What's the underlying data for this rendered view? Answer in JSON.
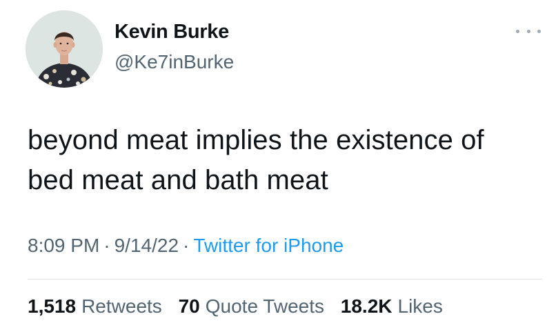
{
  "author": {
    "name": "Kevin Burke",
    "handle": "@Ke7inBurke",
    "avatar": "profile-photo"
  },
  "tweet": {
    "lines": [
      "beyond meat implies the existence of",
      "bed meat and bath meat"
    ]
  },
  "meta": {
    "time": "8:09 PM",
    "separator": "·",
    "date": "9/14/22",
    "source": "Twitter for iPhone"
  },
  "stats": {
    "retweets": {
      "count": "1,518",
      "label": "Retweets"
    },
    "quotes": {
      "count": "70",
      "label": "Quote Tweets"
    },
    "likes": {
      "count": "18.2K",
      "label": "Likes"
    }
  },
  "colors": {
    "text": "#0f1419",
    "secondary": "#536471",
    "link": "#1d9bf0",
    "divider": "#dfe3e6"
  },
  "icons": {
    "more": "more-horizontal-icon"
  }
}
